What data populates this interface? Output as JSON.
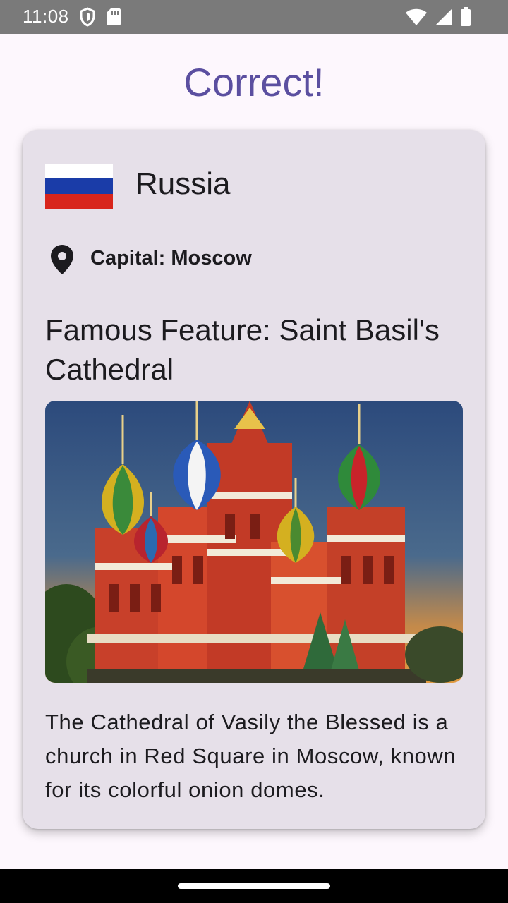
{
  "status_bar": {
    "time": "11:08"
  },
  "result": {
    "title": "Correct!"
  },
  "country": {
    "name": "Russia",
    "flag_colors": [
      "#ffffff",
      "#1a3ca8",
      "#d8251c"
    ],
    "capital_label": "Capital: Moscow"
  },
  "feature": {
    "title": "Famous Feature: Saint Basil's Cathedral",
    "description": "The Cathedral of Vasily the Blessed is a church in Red Square in Moscow, known for its colorful onion domes."
  },
  "colors": {
    "accent": "#5b4fa0",
    "card_background": "#e6e0e9",
    "page_background": "#fdf7fd"
  }
}
